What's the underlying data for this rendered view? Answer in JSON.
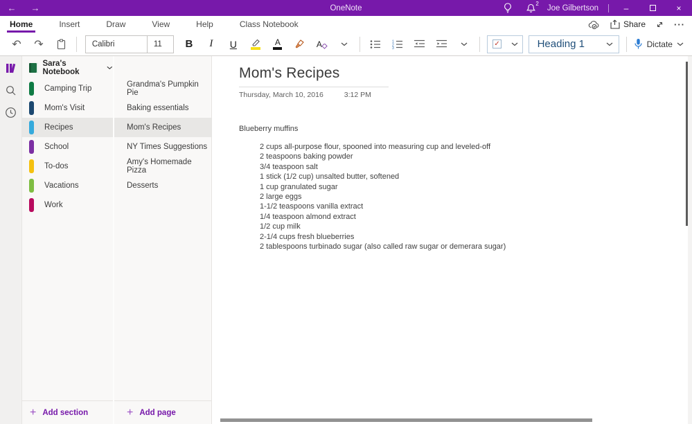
{
  "titlebar": {
    "app_title": "OneNote",
    "user_name": "Joe Gilbertson",
    "notification_count": "2",
    "back": "←",
    "forward": "→",
    "minimize": "–",
    "close": "×"
  },
  "ribbon": {
    "tabs": [
      {
        "label": "Home"
      },
      {
        "label": "Insert"
      },
      {
        "label": "Draw"
      },
      {
        "label": "View"
      },
      {
        "label": "Help"
      },
      {
        "label": "Class Notebook"
      }
    ],
    "share_label": "Share",
    "ellipsis": "···"
  },
  "toolbar": {
    "undo": "↶",
    "redo": "↷",
    "bold": "B",
    "italic": "I",
    "underline": "U",
    "font_color_letter": "A",
    "clear_format_letter": "A",
    "font_name": "Calibri",
    "font_size": "11",
    "todo_check": "✓",
    "style_name": "Heading 1",
    "dictate_label": "Dictate"
  },
  "sidebar": {
    "notebook_name": "Sara's Notebook",
    "sections": [
      {
        "label": "Camping Trip",
        "color": "#0F7B44",
        "selected": false
      },
      {
        "label": "Mom's Visit",
        "color": "#1C4870",
        "selected": false
      },
      {
        "label": "Recipes",
        "color": "#35AADC",
        "selected": true
      },
      {
        "label": "School",
        "color": "#7C2FA3",
        "selected": false
      },
      {
        "label": "To-dos",
        "color": "#F5C110",
        "selected": false
      },
      {
        "label": "Vacations",
        "color": "#7FBD42",
        "selected": false
      },
      {
        "label": "Work",
        "color": "#B80B5E",
        "selected": false
      }
    ],
    "add_section_plus": "+",
    "add_section_label": "Add section",
    "pages": [
      {
        "label": "Grandma's Pumpkin Pie",
        "selected": false
      },
      {
        "label": "Baking essentials",
        "selected": false
      },
      {
        "label": "Mom's Recipes",
        "selected": true
      },
      {
        "label": "NY Times Suggestions",
        "selected": false
      },
      {
        "label": "Amy's Homemade Pizza",
        "selected": false
      },
      {
        "label": "Desserts",
        "selected": false
      }
    ],
    "add_page_plus": "+",
    "add_page_label": "Add page"
  },
  "page": {
    "title": "Mom's Recipes",
    "date": "Thursday, March 10, 2016",
    "time": "3:12 PM",
    "body_heading": "Blueberry muffins",
    "ingredients": [
      "2 cups all-purpose flour, spooned into measuring cup and leveled-off",
      "2 teaspoons baking powder",
      "3/4 teaspoon salt",
      "1 stick (1/2 cup) unsalted butter, softened",
      "1 cup granulated sugar",
      "2 large eggs",
      "1-1/2 teaspoons vanilla extract",
      "1/4 teaspoon almond extract",
      "1/2 cup milk",
      "2-1/4 cups fresh blueberries",
      "2 tablespoons turbinado sugar (also called raw sugar or demerara sugar)"
    ]
  },
  "colors": {
    "accent": "#7719AA",
    "heading_blue": "#1F4E79",
    "dictate_blue": "#2B7CD3"
  }
}
